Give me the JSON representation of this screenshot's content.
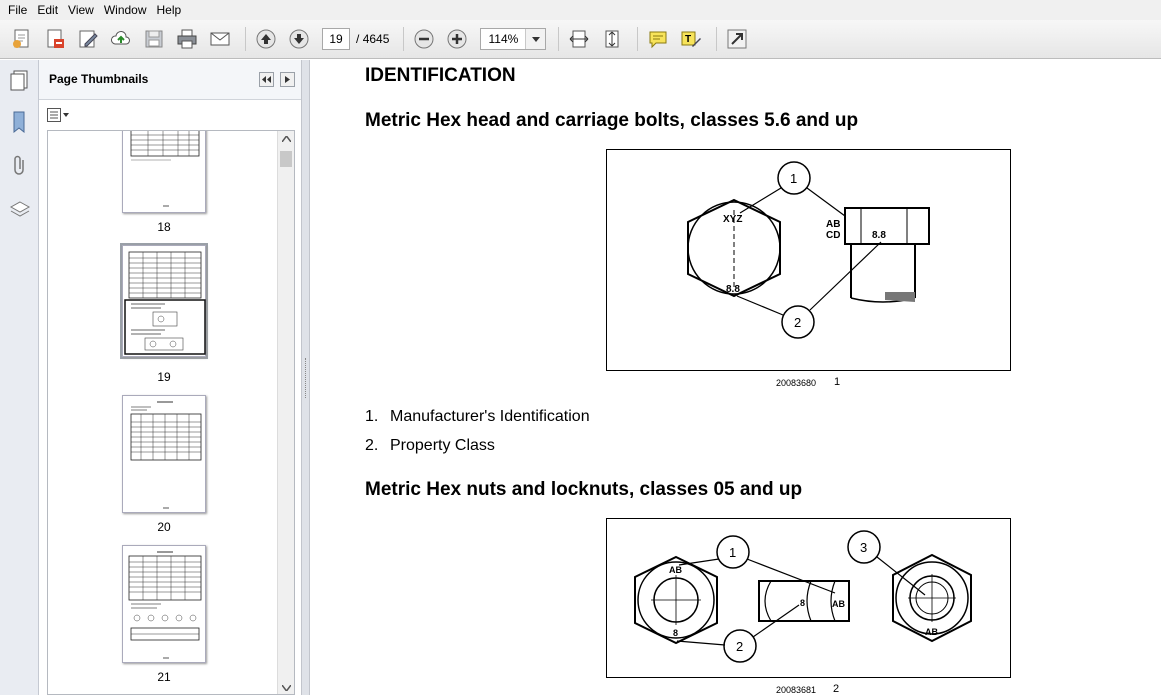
{
  "menu": [
    "File",
    "Edit",
    "View",
    "Window",
    "Help"
  ],
  "toolbar": {
    "current_page": "19",
    "page_separator": "/",
    "total_pages": "4645",
    "zoom": "114%"
  },
  "panel": {
    "title": "Page Thumbnails",
    "thumbnails": [
      {
        "label": "18"
      },
      {
        "label": "19"
      },
      {
        "label": "20"
      },
      {
        "label": "21"
      }
    ]
  },
  "doc": {
    "heading": "IDENTIFICATION",
    "section1_title": "Metric Hex head and carriage bolts, classes 5.6 and up",
    "figure1": {
      "caption": "20083680",
      "number": "1",
      "callouts": [
        "1",
        "2"
      ],
      "marks": [
        "XYZ",
        "8.8",
        "AB",
        "CD",
        "8.8"
      ]
    },
    "list": [
      {
        "num": "1.",
        "text": "Manufacturer's Identification"
      },
      {
        "num": "2.",
        "text": "Property Class"
      }
    ],
    "section2_title": "Metric Hex nuts and locknuts, classes 05 and up",
    "figure2": {
      "caption": "20083681",
      "number": "2",
      "callouts": [
        "1",
        "3",
        "2"
      ],
      "marks": [
        "AB",
        "8",
        "8",
        "AB",
        "AB"
      ]
    }
  }
}
